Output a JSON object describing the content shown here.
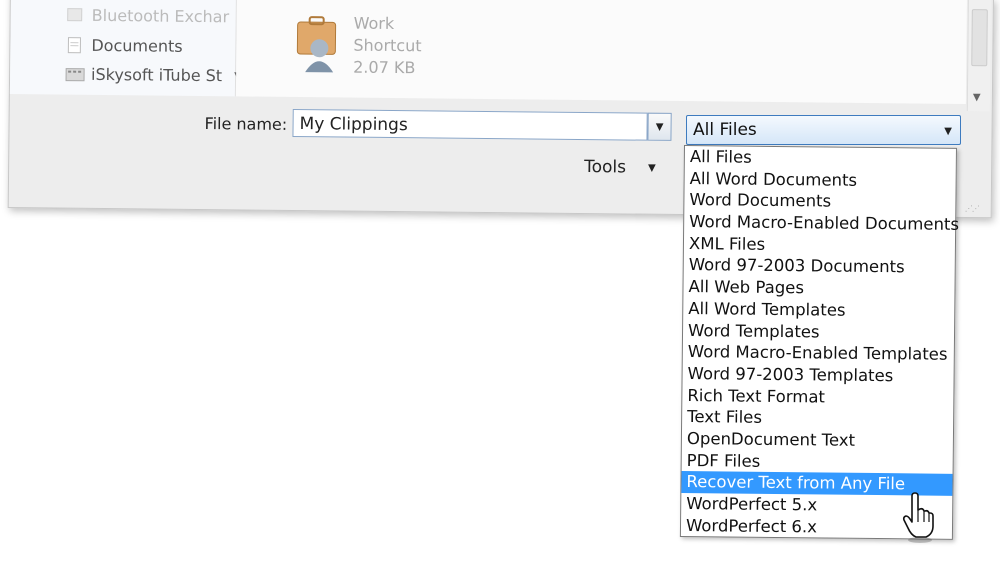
{
  "nav": {
    "items": [
      {
        "label": "Bluetooth Exchar",
        "faded": true
      },
      {
        "label": "Documents",
        "faded": false
      },
      {
        "label": "iSkysoft iTube St",
        "faded": false
      }
    ]
  },
  "file": {
    "name_line1": "Work",
    "name_line2": "Shortcut",
    "size": "2.07 KB"
  },
  "filename": {
    "label": "File name:",
    "value": "My Clippings"
  },
  "tools_label": "Tools",
  "filetype": {
    "selected": "All Files",
    "options": [
      "All Files",
      "All Word Documents",
      "Word Documents",
      "Word Macro-Enabled Documents",
      "XML Files",
      "Word 97-2003 Documents",
      "All Web Pages",
      "All Word Templates",
      "Word Templates",
      "Word Macro-Enabled Templates",
      "Word 97-2003 Templates",
      "Rich Text Format",
      "Text Files",
      "OpenDocument Text",
      "PDF Files",
      "Recover Text from Any File",
      "WordPerfect 5.x",
      "WordPerfect 6.x"
    ],
    "highlighted": "Recover Text from Any File"
  },
  "colors": {
    "highlight": "#3399ff",
    "combo_border": "#3e7bbf"
  }
}
